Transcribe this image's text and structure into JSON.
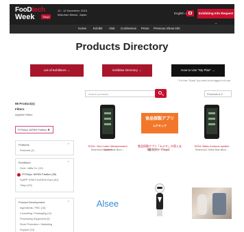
{
  "header": {
    "logo_line1_a": "FooD",
    "logo_line1_b": "tech",
    "logo_line2": "Week",
    "logo_badge": "Tokyo",
    "event_line1": "10 - 12 December, 2024",
    "event_line2": "Makuhari Messe, Japan",
    "language": "English ∨",
    "exhibit_button": "Exhibiting Info Request →"
  },
  "nav": [
    "Home",
    "Exhibit",
    "Visit",
    "Conference",
    "Press",
    "Previous Show Info"
  ],
  "page_title": "Products Directory",
  "action_buttons": {
    "list_of_exhibitors": "List of Exhibitors →",
    "exhibitor_directory": "Exhibitor Directory →",
    "how_to_use": "How to Use \"My Plan\" →"
  },
  "note": "* For free \"Guest\" you need to be logged in to use",
  "search": {
    "placeholder": "Search products"
  },
  "sort": {
    "value": "Products A-Z"
  },
  "sidebar": {
    "product_count": "98 Product(s)",
    "filters_heading": "Filters",
    "applied_label": "Applied Filters",
    "applied_chip": "FHTokyo JAPAN Pavilion ✖",
    "panels": [
      {
        "title": "Features",
        "options": [
          "Featured (1)"
        ]
      },
      {
        "title": "Exhibitors",
        "options": [
          "Zone: Jaffa Co. (12)",
          "FHTokyo JAPAN Pavilion (98)",
          "ScaPP XSW FoodTech Expo (51)",
          "Tokyo (23)"
        ]
      },
      {
        "title": "Product Development",
        "options": [
          "Ingredients / PBC (15)",
          "Consulting / Packaging (11)",
          "Processing Equipment (9)",
          "Store Promotion / Marketing",
          "Support (13)"
        ]
      }
    ]
  },
  "products": [
    {
      "title": "SOHL: Non Laser Measurement system",
      "sub": "Shamrock Tohko Bak Bucx...",
      "image": "phone-device"
    },
    {
      "title": "食品採製アプリ「ムテキ」の導入支援アプリ（Tools）",
      "sub": "株式会社ハイウェイ...",
      "image": "orange-banner",
      "banner_title": "食品採製アプリ",
      "banner_sub": "ムテキック"
    },
    {
      "title": "SOHL Basic Immune system",
      "sub": "Shamrock Tohko Bak Bucx...",
      "image": "phone-device"
    },
    {
      "title": "Alsee",
      "sub": "",
      "image": "alsee-logo",
      "logo_text": "Alsee"
    },
    {
      "title": "",
      "sub": "",
      "image": "robot"
    },
    {
      "title": "",
      "sub": "",
      "image": "photo"
    }
  ]
}
